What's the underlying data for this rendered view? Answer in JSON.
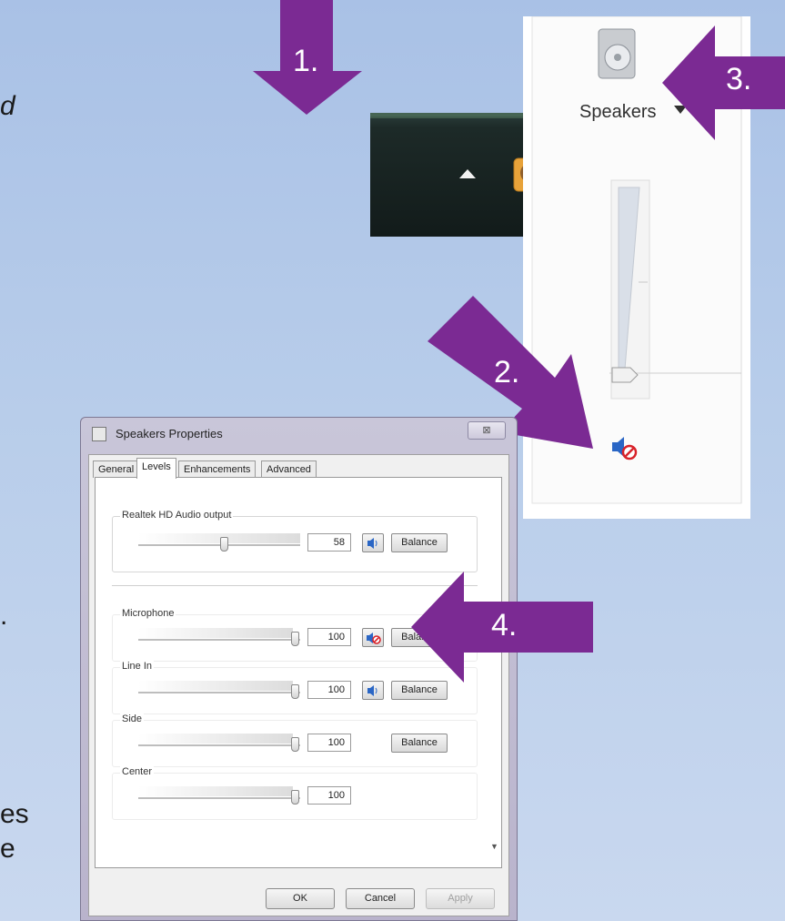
{
  "fragments": {
    "top_left_letter": "d",
    "mid_left_char": ".",
    "bottom_left_line1": "es",
    "bottom_left_line2": "e"
  },
  "callouts": {
    "step1": "1.",
    "step2": "2.",
    "step3": "3.",
    "step4": "4.",
    "color": "#7b2a93"
  },
  "taskbar": {
    "icons": [
      "show-hidden-icons-arrow",
      "action-center-icon",
      "network-icon",
      "volume-icon"
    ]
  },
  "mixer": {
    "device_label": "Speakers",
    "device_icon": "speaker-icon",
    "mute_icon": "muted-speaker-icon",
    "volume_fraction": 0.0
  },
  "dialog": {
    "title": "Speakers Properties",
    "close_label": "⊠",
    "tabs": [
      "General",
      "Levels",
      "Enhancements",
      "Advanced"
    ],
    "active_tab": "Levels",
    "main_channel": {
      "label": "Realtek HD Audio output",
      "value": "58",
      "fraction": 0.58,
      "button": "Balance",
      "muted": false
    },
    "channels": [
      {
        "label": "Microphone",
        "value": "100",
        "fraction": 1.0,
        "speaker": true,
        "muted": true,
        "button": "Balance"
      },
      {
        "label": "Line In",
        "value": "100",
        "fraction": 1.0,
        "speaker": true,
        "muted": false,
        "button": "Balance"
      },
      {
        "label": "Side",
        "value": "100",
        "fraction": 1.0,
        "speaker": false,
        "muted": false,
        "button": "Balance"
      },
      {
        "label": "Center",
        "value": "100",
        "fraction": 1.0,
        "speaker": false,
        "muted": false,
        "button": ""
      }
    ],
    "buttons": {
      "ok": "OK",
      "cancel": "Cancel",
      "apply": "Apply"
    }
  }
}
